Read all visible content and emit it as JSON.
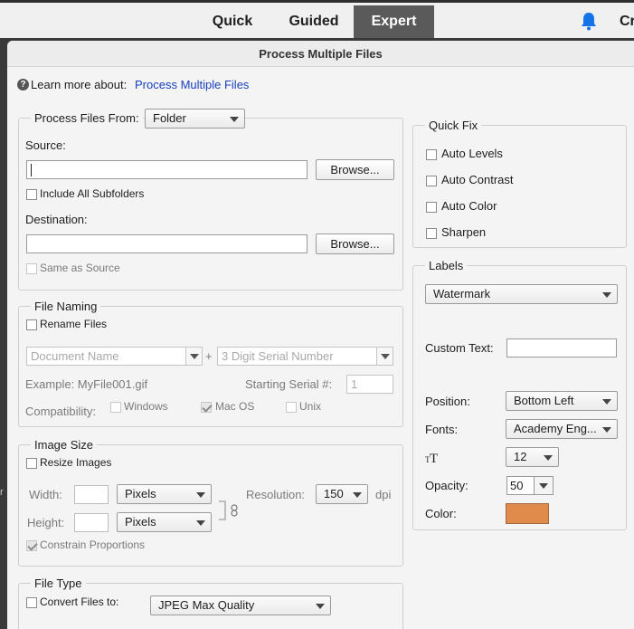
{
  "modes": [
    "Quick",
    "Guided",
    "Expert"
  ],
  "top_right_text": "Cr",
  "edge_text": "r",
  "dialog": {
    "title": "Process Multiple Files",
    "learn_more_label": "Learn more about:",
    "learn_more_link": "Process Multiple Files"
  },
  "process": {
    "from_label": "Process Files From:",
    "from_value": "Folder",
    "source_label": "Source:",
    "browse": "Browse...",
    "include_subfolders": "Include All Subfolders",
    "destination_label": "Destination:",
    "same_as_source": "Same as Source"
  },
  "naming": {
    "legend": "File Naming",
    "rename": "Rename Files",
    "name_placeholder": "Document Name",
    "plus": "+",
    "serial_placeholder": "3 Digit Serial Number",
    "example": "Example: MyFile001.gif",
    "starting_serial_label": "Starting Serial #:",
    "starting_serial_value": "1",
    "compat_label": "Compatibility:",
    "windows": "Windows",
    "macos": "Mac OS",
    "unix": "Unix"
  },
  "image_size": {
    "legend": "Image Size",
    "resize": "Resize Images",
    "width_label": "Width:",
    "height_label": "Height:",
    "unit": "Pixels",
    "resolution_label": "Resolution:",
    "resolution_value": "150",
    "dpi": "dpi",
    "constrain": "Constrain Proportions"
  },
  "file_type": {
    "legend": "File Type",
    "convert": "Convert Files to:",
    "format": "JPEG Max Quality"
  },
  "quick_fix": {
    "legend": "Quick Fix",
    "items": [
      "Auto Levels",
      "Auto Contrast",
      "Auto Color",
      "Sharpen"
    ]
  },
  "labels": {
    "legend": "Labels",
    "type": "Watermark",
    "custom_text_label": "Custom Text:",
    "custom_text_value": "",
    "position_label": "Position:",
    "position_value": "Bottom Left",
    "fonts_label": "Fonts:",
    "font_value": "Academy Eng...",
    "size_value": "12",
    "opacity_label": "Opacity:",
    "opacity_value": "50",
    "color_label": "Color:",
    "color_hex": "#e08a4c"
  }
}
